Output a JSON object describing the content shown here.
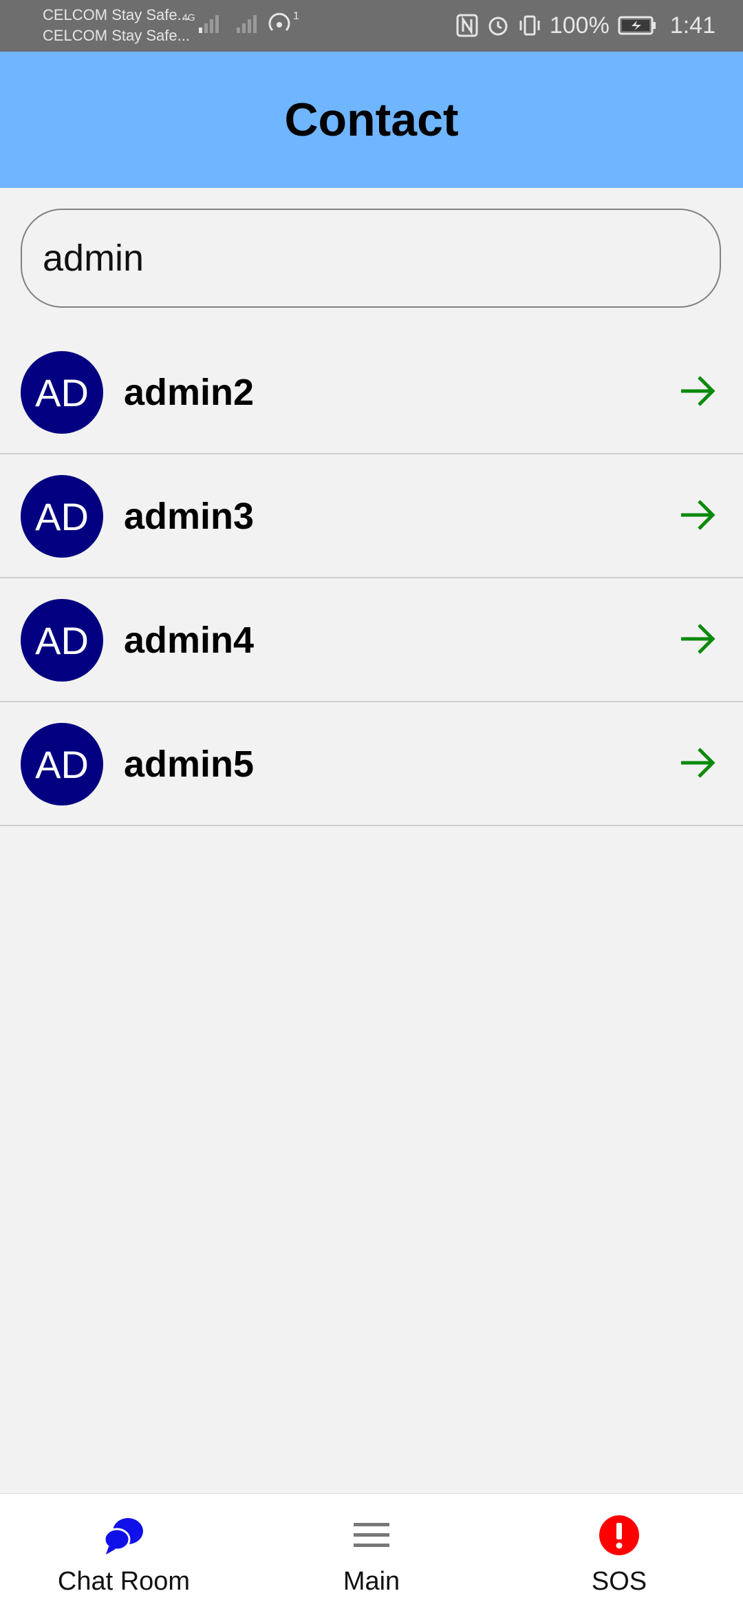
{
  "status_bar": {
    "carrier_1": "CELCOM Stay Safe...",
    "carrier_2": "CELCOM Stay Safe...",
    "network_type": "4G",
    "hotspot_count": "1",
    "battery": "100%",
    "time": "1:41"
  },
  "header": {
    "title": "Contact"
  },
  "search": {
    "value": "admin",
    "placeholder": ""
  },
  "contacts": [
    {
      "initials": "AD",
      "name": "admin2"
    },
    {
      "initials": "AD",
      "name": "admin3"
    },
    {
      "initials": "AD",
      "name": "admin4"
    },
    {
      "initials": "AD",
      "name": "admin5"
    }
  ],
  "bottom_nav": {
    "items": [
      {
        "label": "Chat Room",
        "icon": "chat-bubbles-icon"
      },
      {
        "label": "Main",
        "icon": "menu-icon"
      },
      {
        "label": "SOS",
        "icon": "alert-icon"
      }
    ]
  },
  "colors": {
    "header_bg": "#6fb5ff",
    "avatar_bg": "#020080",
    "arrow": "#0a8a0a",
    "chat_icon": "#1010e8",
    "sos_icon": "#ff0000"
  }
}
